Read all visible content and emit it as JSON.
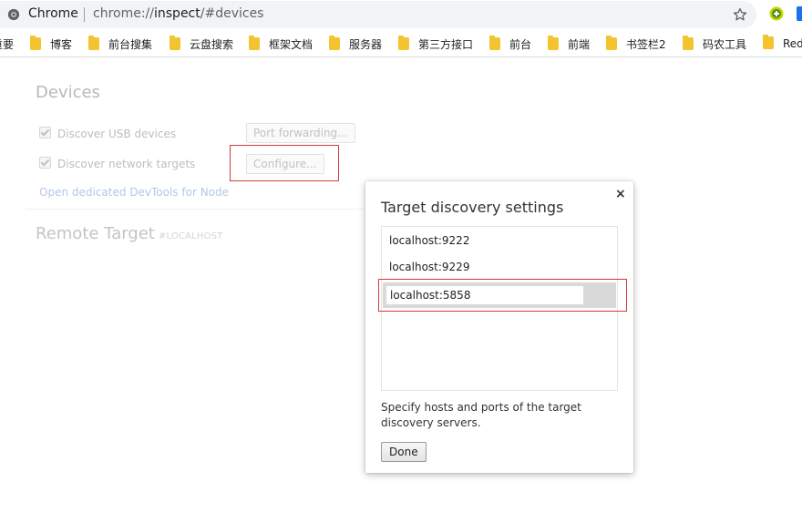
{
  "browser": {
    "app_name": "Chrome",
    "url_prefix": "chrome://",
    "url_host": "inspect",
    "url_path": "/#devices"
  },
  "bookmarks": [
    {
      "label": "重要"
    },
    {
      "label": "博客"
    },
    {
      "label": "前台搜集"
    },
    {
      "label": "云盘搜索"
    },
    {
      "label": "框架文档"
    },
    {
      "label": "服务器"
    },
    {
      "label": "第三方接口"
    },
    {
      "label": "前台"
    },
    {
      "label": "前端"
    },
    {
      "label": "书签栏2"
    },
    {
      "label": "码农工具"
    },
    {
      "label": "Red"
    }
  ],
  "devices": {
    "heading": "Devices",
    "usb_label": "Discover USB devices",
    "usb_checked": true,
    "network_label": "Discover network targets",
    "network_checked": true,
    "port_forwarding_label": "Port forwarding...",
    "configure_label": "Configure...",
    "node_link": "Open dedicated DevTools for Node"
  },
  "remote": {
    "heading": "Remote Target",
    "tag": "#LOCALHOST"
  },
  "dialog": {
    "title": "Target discovery settings",
    "close_glyph": "×",
    "targets": [
      "localhost:9222",
      "localhost:9229"
    ],
    "editing_value": "localhost:5858",
    "note": "Specify hosts and ports of the target discovery servers.",
    "done_label": "Done"
  },
  "colors": {
    "highlight_border": "#d33a3a",
    "bookmark_folder": "#f4c430",
    "omnibox_bg": "#f1f3f4"
  }
}
